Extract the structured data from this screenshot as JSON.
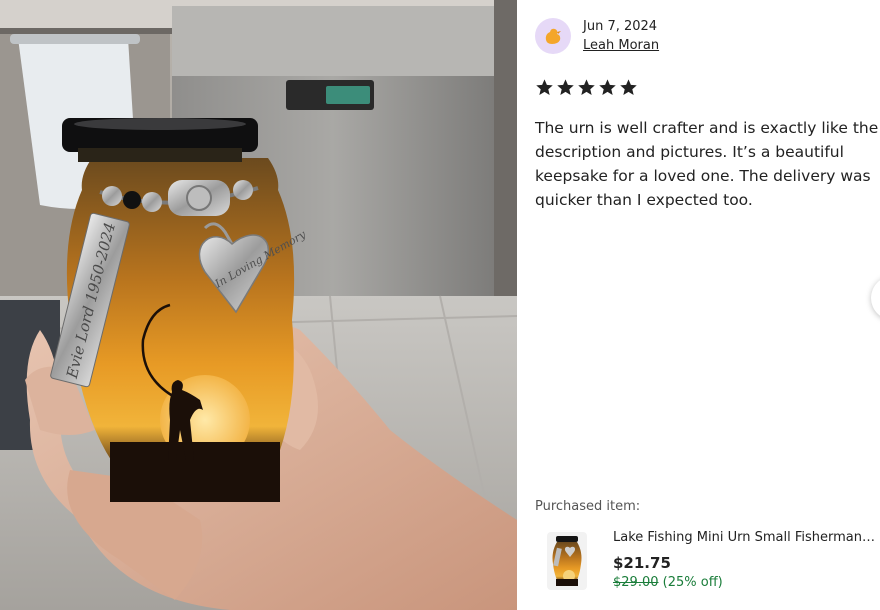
{
  "review": {
    "date": "Jun 7, 2024",
    "reviewer_name": "Leah Moran",
    "rating": 5,
    "text": "The urn is well crafter and is exactly like the description and pictures. It’s a beautiful keepsake for a loved one. The delivery was quicker than I expected too."
  },
  "photo": {
    "urn_tag_text": "Evie Lord 1950-2024",
    "urn_charm_text": "In Loving Memory"
  },
  "purchase": {
    "label": "Purchased item:",
    "item_title": "Lake Fishing Mini Urn Small Fisherman Urn",
    "price": "$21.75",
    "original_price": "$29.00",
    "discount": "(25% off)"
  },
  "colors": {
    "star": "#222222",
    "sale_green": "#1a7d3a",
    "avatar_bg": "#e6d9f7",
    "avatar_icon": "#f4a62a"
  },
  "icons": {
    "avatar": "bird-icon",
    "rating": "star-icon",
    "carousel": "chevron-right-icon"
  }
}
